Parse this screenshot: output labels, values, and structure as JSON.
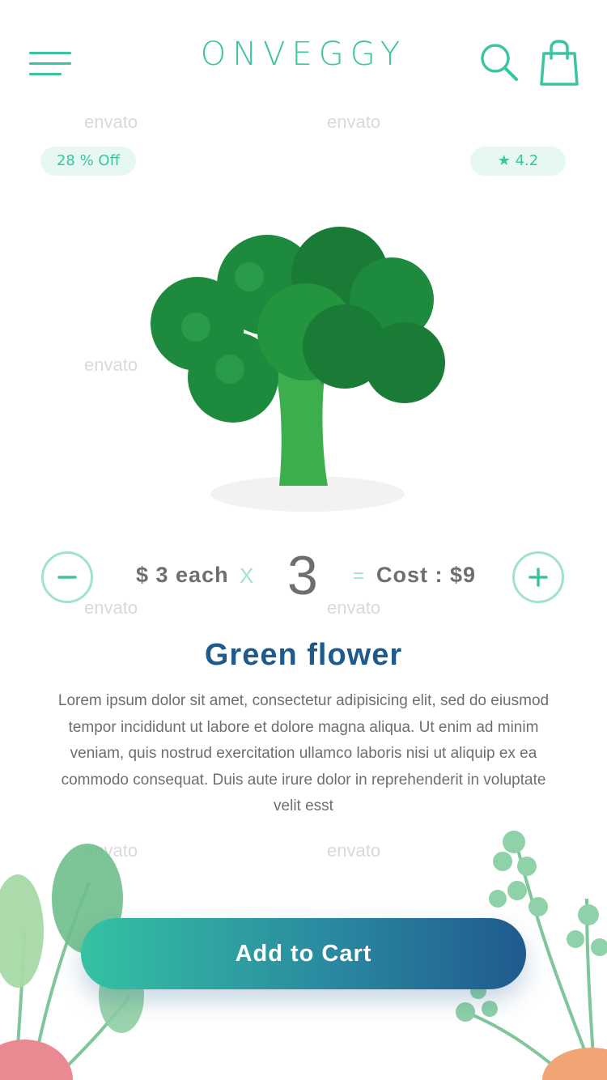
{
  "header": {
    "logo": "ONVEGGY",
    "icons": {
      "menu": "menu-icon",
      "search": "search-icon",
      "cart": "shopping-bag-icon"
    }
  },
  "watermark": "envato",
  "badges": {
    "discount": "28 % Off",
    "rating": "4.2"
  },
  "quantity": {
    "price_each": "$ 3 each",
    "times": "X",
    "count": "3",
    "equals": "=",
    "cost": "Cost : $9"
  },
  "product": {
    "name": "Green flower",
    "description": "Lorem ipsum dolor sit amet, consectetur adipisicing elit, sed do eiusmod tempor incididunt ut labore et dolore magna aliqua. Ut enim ad minim veniam, quis nostrud exercitation ullamco laboris nisi ut aliquip ex ea commodo consequat. Duis aute irure dolor in reprehenderit in voluptate velit esst"
  },
  "cta": {
    "label": "Add to Cart"
  },
  "colors": {
    "accent": "#3cc3a0",
    "title": "#1f5a8e",
    "text": "#6e6e6e",
    "pill_bg": "#e7f8f3"
  }
}
